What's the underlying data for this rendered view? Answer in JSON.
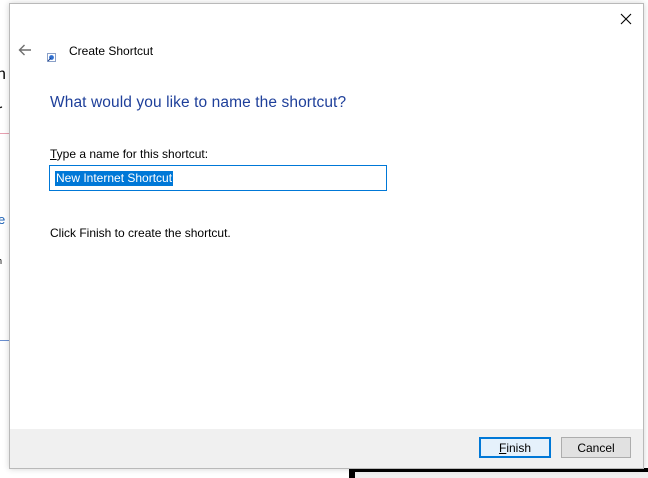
{
  "background": {
    "letters": [
      "n",
      "r",
      "e",
      "h"
    ]
  },
  "dialog": {
    "title": "Create Shortcut",
    "heading": "What would you like to name the shortcut?",
    "field_label_accel": "T",
    "field_label_rest": "ype a name for this shortcut:",
    "name_value": "New Internet Shortcut",
    "instruction": "Click Finish to create the shortcut.",
    "buttons": {
      "finish_accel": "F",
      "finish_rest": "inish",
      "cancel": "Cancel"
    },
    "icons": {
      "back": "back-arrow-icon",
      "close": "close-icon",
      "title": "internet-shortcut-icon"
    },
    "colors": {
      "heading": "#1e3f9a",
      "accent": "#0078d7",
      "footer": "#f0f0f0"
    }
  }
}
